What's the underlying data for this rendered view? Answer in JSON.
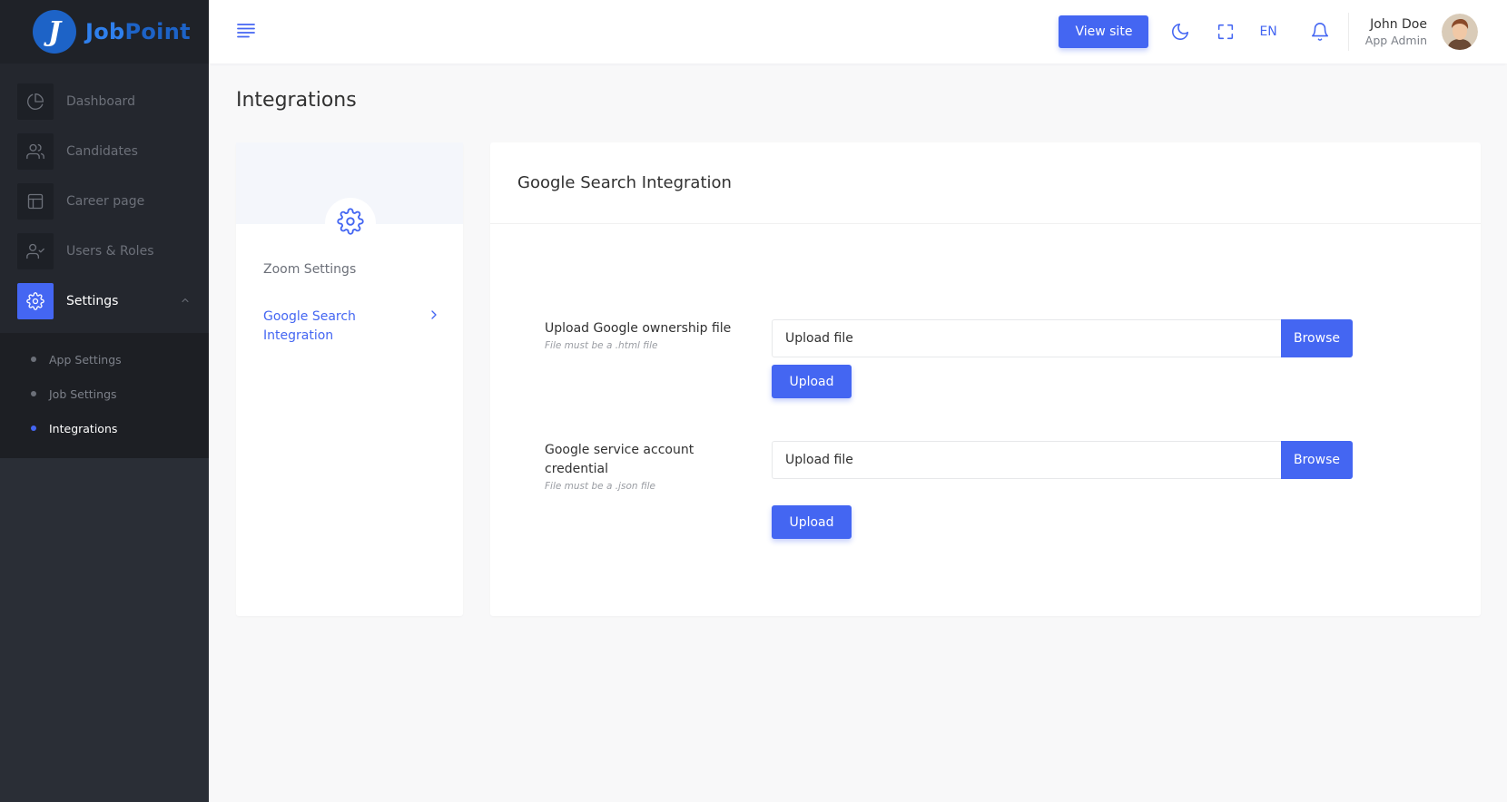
{
  "brand": {
    "logo_letter": "J",
    "name_a": "Job",
    "name_b": "Point"
  },
  "sidebar": {
    "items": [
      {
        "label": "Dashboard",
        "icon": "pie-chart-icon"
      },
      {
        "label": "Candidates",
        "icon": "users-icon"
      },
      {
        "label": "Career page",
        "icon": "layout-icon"
      },
      {
        "label": "Users & Roles",
        "icon": "user-check-icon"
      },
      {
        "label": "Settings",
        "icon": "gear-icon",
        "active": true,
        "expanded": true
      }
    ],
    "subitems": [
      {
        "label": "App Settings"
      },
      {
        "label": "Job Settings"
      },
      {
        "label": "Integrations",
        "active": true
      }
    ]
  },
  "header": {
    "view_site_label": "View site",
    "language": "EN",
    "user_name": "John Doe",
    "user_role": "App Admin"
  },
  "page": {
    "title": "Integrations"
  },
  "settings_nav": {
    "items": [
      {
        "label": "Zoom Settings"
      },
      {
        "label": "Google Search Integration",
        "active": true
      }
    ]
  },
  "card": {
    "title": "Google Search Integration",
    "fields": [
      {
        "label": "Upload Google ownership file",
        "hint": "File must be a .html file",
        "placeholder": "Upload file",
        "browse_label": "Browse",
        "upload_label": "Upload"
      },
      {
        "label": "Google service account credential",
        "hint": "File must be a .json file",
        "placeholder": "Upload file",
        "browse_label": "Browse",
        "upload_label": "Upload"
      }
    ]
  },
  "colors": {
    "accent": "#4466f2",
    "sidebar_bg": "#2a2e36",
    "page_bg": "#f8f8f9"
  }
}
